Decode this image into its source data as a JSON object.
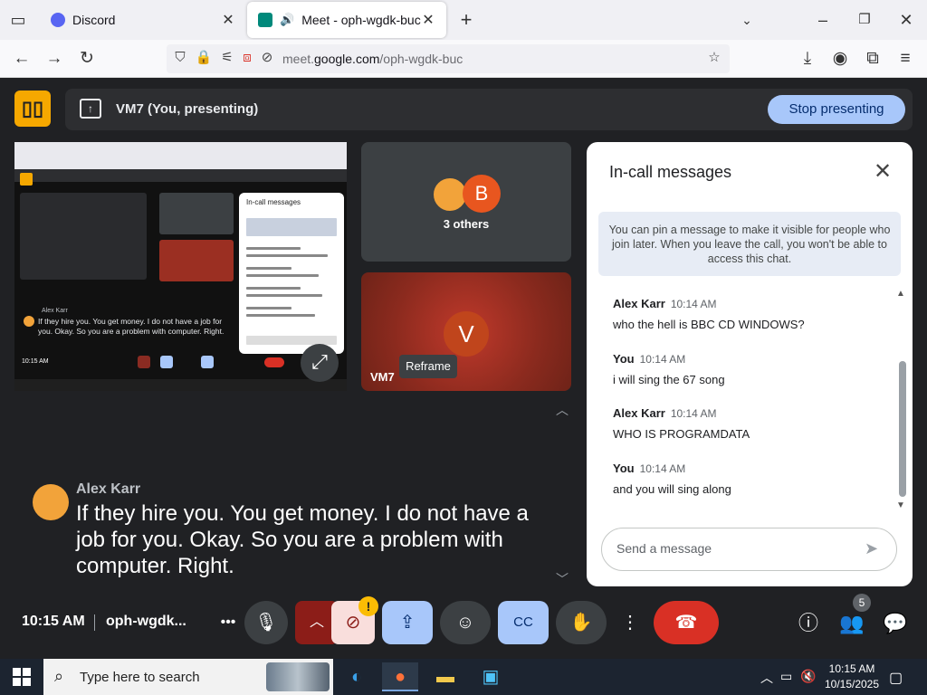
{
  "browser": {
    "tabs": [
      {
        "title": "Discord",
        "favicon_color": "#5865F2"
      },
      {
        "title": "Meet - oph-wgdk-buc",
        "favicon_color": "#00897B"
      }
    ],
    "url_prefix": "meet.",
    "url_domain": "google.com",
    "url_path": "/oph-wgdk-buc"
  },
  "meet": {
    "presenting_label": "VM7 (You, presenting)",
    "stop_presenting": "Stop presenting",
    "others_label": "3 others",
    "avatar_b": "B",
    "avatar_v": "V",
    "vm7_name": "VM7",
    "reframe": "Reframe",
    "caption": {
      "speaker": "Alex Karr",
      "text": "If they hire you. You get money. I do not have a job for you. Okay. So you are a problem with computer. Right."
    },
    "clock": "10:15 AM",
    "meeting_code": "oph-wgdk...",
    "people_count": "5",
    "warning_badge": "!"
  },
  "chat": {
    "title": "In-call messages",
    "info": "You can pin a message to make it visible for people who join later. When you leave the call, you won't be able to access this chat.",
    "messages": [
      {
        "sender": "Alex Karr",
        "time": "10:14 AM",
        "text": "who the hell is BBC CD WINDOWS?"
      },
      {
        "sender": "You",
        "time": "10:14 AM",
        "text": "i will sing the 67 song"
      },
      {
        "sender": "Alex Karr",
        "time": "10:14 AM",
        "text": "WHO IS PROGRAMDATA"
      },
      {
        "sender": "You",
        "time": "10:14 AM",
        "text": "and you will sing along"
      }
    ],
    "input_placeholder": "Send a message"
  },
  "taskbar": {
    "search_placeholder": "Type here to search",
    "time": "10:15 AM",
    "date": "10/15/2025"
  },
  "preview": {
    "caption_name": "Alex Karr",
    "caption_text": "If they hire you. You get money. I do not have a job for you. Okay. So you are a problem with computer. Right.",
    "panel_title": "In-call messages",
    "clock": "10:15 AM"
  }
}
